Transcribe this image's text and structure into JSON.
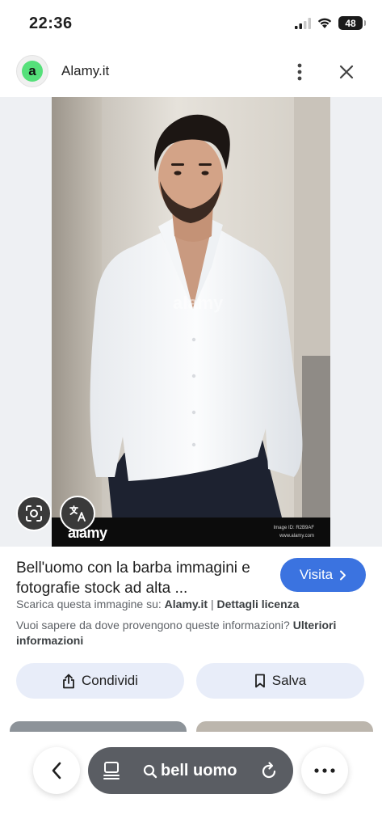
{
  "status_bar": {
    "time": "22:36",
    "battery": "48",
    "icons": [
      "signal-icon",
      "wifi-icon",
      "battery-icon"
    ]
  },
  "site": {
    "logo_letter": "a",
    "name": "Alamy.it"
  },
  "image": {
    "watermark": "alamy",
    "caption_logo": "alamy",
    "image_id": "Image ID: R2B9AF",
    "caption_url": "www.alamy.com"
  },
  "result": {
    "title": "Bell'uomo con la barba immagini e fotografie stock ad alta ...",
    "visit_label": "Visita",
    "source_prefix": "Scarica questa immagine su:",
    "source_site": "Alamy.it",
    "source_separator": " | ",
    "license_link": "Dettagli licenza",
    "origin_question": "Vuoi sapere da dove provengono queste informazioni?",
    "origin_link": "Ulteriori informazioni"
  },
  "actions": {
    "share_label": "Condividi",
    "save_label": "Salva"
  },
  "bottom_nav": {
    "query": "bell uomo"
  },
  "colors": {
    "accent": "#3b73e0",
    "logo_green": "#55e07a",
    "button_bg": "#e8edf9",
    "pill_bg": "#5a5d63"
  }
}
